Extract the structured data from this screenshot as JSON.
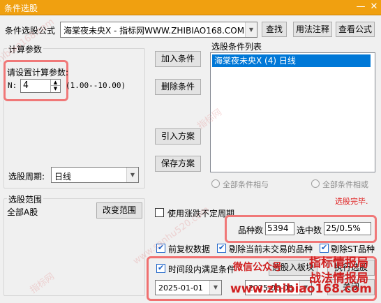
{
  "window": {
    "title": "条件选股",
    "controls": {
      "minimize": "—",
      "close": "✕"
    }
  },
  "formula": {
    "label": "条件选股公式",
    "value": "海棠夜未央X  - 指标网WWW.ZHIBIAO168.COM",
    "find": "查找",
    "usage": "用法注释",
    "view": "查看公式"
  },
  "calc": {
    "legend": "计算参数",
    "prompt": "请设置计算参数:",
    "param_label": "N:",
    "param_value": "4",
    "param_range": "(1.00--10.00)",
    "period_label": "选股周期:",
    "period_value": "日线"
  },
  "actions": {
    "add": "加入条件",
    "remove": "删除条件",
    "import": "引入方案",
    "save": "保存方案"
  },
  "conditions": {
    "label": "选股条件列表",
    "items": [
      "海棠夜未央X (4) 日线"
    ]
  },
  "logic": {
    "all_and": "全部条件相与",
    "all_or": "全部条件相或"
  },
  "status": {
    "done": "选股完毕.",
    "total_label": "品种数",
    "total_value": "5394",
    "selected_label": "选中数",
    "selected_value": "25/0.5%"
  },
  "scope": {
    "legend": "选股范围",
    "value": "全部A股",
    "change": "改变范围"
  },
  "options": {
    "irregular": "使用涨跌不定周期",
    "adjusted": "前复权数据",
    "exclude_untraded": "剔除当前未交易的品种",
    "exclude_st": "剔除ST品种",
    "time_range": "时间段内满足条件",
    "start_date": "2025-01-01",
    "end_date": "2025-06-08"
  },
  "bottom": {
    "to_board": "选股入板块",
    "execute": "执行选股",
    "close": "关闭"
  },
  "watermarks": {
    "wechat": "微信公众号",
    "brand1": "指标情报局",
    "brand2": "战法情报局",
    "url": "www.zhibiao168.com",
    "diag1": "www.zhibiao168.com",
    "diag2": "指标网",
    "diag3": "www.sanhu520.com",
    "diag4": "指标网"
  }
}
